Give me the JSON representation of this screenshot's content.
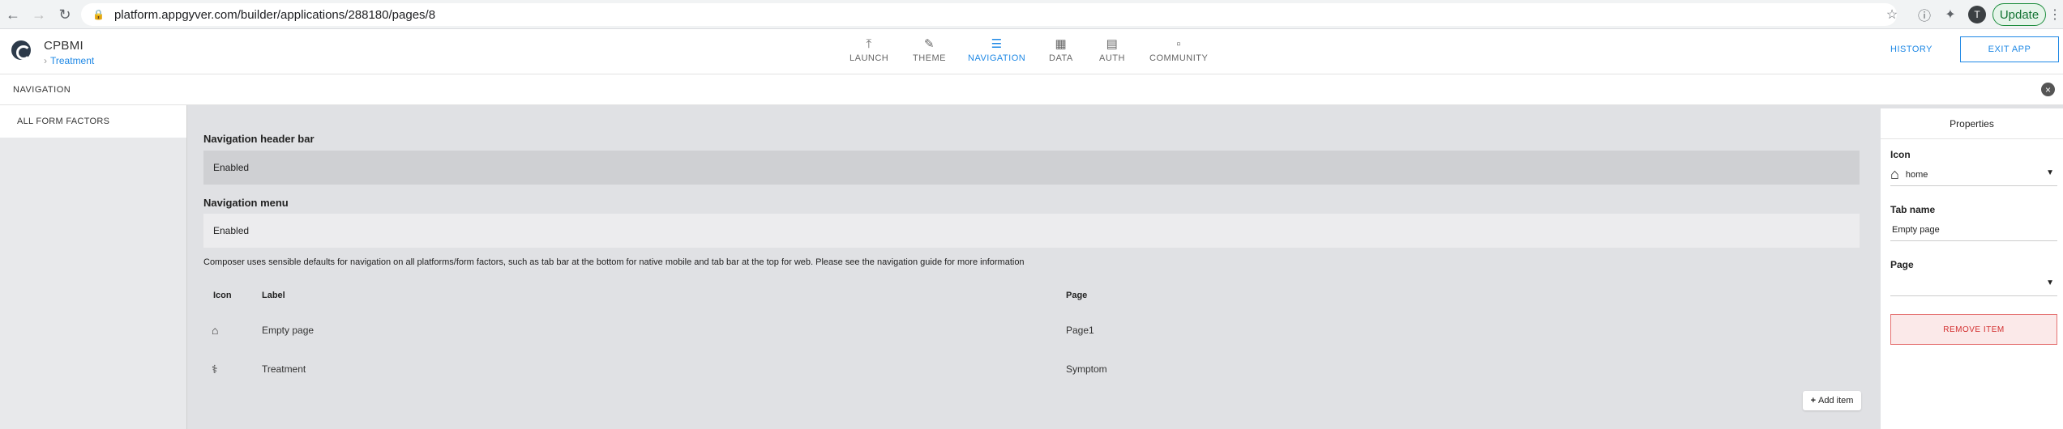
{
  "browser": {
    "url": "platform.appgyver.com/builder/applications/288180/pages/8",
    "avatar_letter": "T",
    "update_label": "Update"
  },
  "header": {
    "app_title": "CPBMI",
    "breadcrumb": "Treatment",
    "tabs": [
      {
        "label": "LAUNCH",
        "icon": "upload-icon"
      },
      {
        "label": "THEME",
        "icon": "pen-icon"
      },
      {
        "label": "NAVIGATION",
        "icon": "list-icon"
      },
      {
        "label": "DATA",
        "icon": "folder-icon"
      },
      {
        "label": "AUTH",
        "icon": "document-icon"
      },
      {
        "label": "COMMUNITY",
        "icon": "chat-icon"
      }
    ],
    "active_tab": "NAVIGATION",
    "history_label": "HISTORY",
    "exit_label": "EXIT APP",
    "accent": "#1e88e5"
  },
  "section": {
    "title": "NAVIGATION"
  },
  "left_panel": {
    "items": [
      {
        "label": "ALL FORM FACTORS"
      }
    ]
  },
  "main": {
    "header_bar_label": "Navigation header bar",
    "header_bar_value": "Enabled",
    "menu_label": "Navigation menu",
    "menu_value": "Enabled",
    "help_text": "Composer uses sensible defaults for navigation on all platforms/form factors, such as tab bar at the bottom for native mobile and tab bar at the top for web. Please see the navigation guide for more information",
    "table": {
      "columns": [
        "Icon",
        "Label",
        "Page"
      ],
      "rows": [
        {
          "icon": "home-icon",
          "label": "Empty page",
          "page": "Page1"
        },
        {
          "icon": "stethoscope-icon",
          "label": "Treatment",
          "page": "Symptom"
        }
      ]
    },
    "add_item_label": "Add item"
  },
  "properties": {
    "title": "Properties",
    "icon_label": "Icon",
    "icon_value": "home",
    "tab_name_label": "Tab name",
    "tab_name_value": "Empty page",
    "page_label": "Page",
    "page_value": "",
    "remove_label": "REMOVE ITEM"
  }
}
